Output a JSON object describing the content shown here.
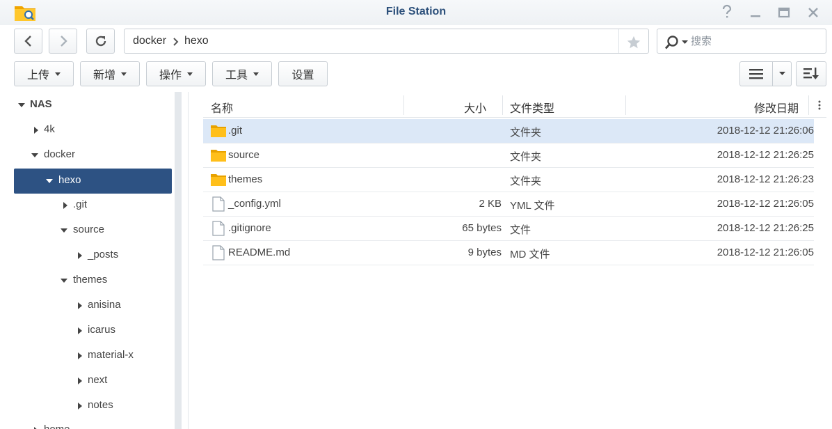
{
  "window": {
    "title": "File Station"
  },
  "nav": {
    "back": "back",
    "forward": "forward",
    "refresh": "refresh"
  },
  "path": {
    "segments": [
      "docker",
      "hexo"
    ]
  },
  "search": {
    "placeholder": "搜索"
  },
  "toolbar": {
    "upload": "上传",
    "create": "新增",
    "action": "操作",
    "tools": "工具",
    "settings": "设置"
  },
  "tree": {
    "root": "NAS",
    "items": [
      {
        "label": "4k"
      },
      {
        "label": "docker"
      },
      {
        "label": "hexo"
      },
      {
        "label": ".git"
      },
      {
        "label": "source"
      },
      {
        "label": "_posts"
      },
      {
        "label": "themes"
      },
      {
        "label": "anisina"
      },
      {
        "label": "icarus"
      },
      {
        "label": "material-x"
      },
      {
        "label": "next"
      },
      {
        "label": "notes"
      },
      {
        "label": "home"
      }
    ]
  },
  "list": {
    "columns": {
      "name": "名称",
      "size": "大小",
      "type": "文件类型",
      "modified": "修改日期"
    },
    "rows": [
      {
        "name": ".git",
        "size": "",
        "type": "文件夹",
        "modified": "2018-12-12 21:26:06",
        "kind": "folder"
      },
      {
        "name": "source",
        "size": "",
        "type": "文件夹",
        "modified": "2018-12-12 21:26:25",
        "kind": "folder"
      },
      {
        "name": "themes",
        "size": "",
        "type": "文件夹",
        "modified": "2018-12-12 21:26:23",
        "kind": "folder"
      },
      {
        "name": "_config.yml",
        "size": "2 KB",
        "type": "YML 文件",
        "modified": "2018-12-12 21:26:05",
        "kind": "file"
      },
      {
        "name": ".gitignore",
        "size": "65 bytes",
        "type": "文件",
        "modified": "2018-12-12 21:26:25",
        "kind": "file"
      },
      {
        "name": "README.md",
        "size": "9 bytes",
        "type": "MD 文件",
        "modified": "2018-12-12 21:26:05",
        "kind": "file"
      }
    ]
  },
  "colors": {
    "accent": "#2d5283",
    "selected_row": "#dce8f7",
    "folder": "#f5b400",
    "title": "#2b4f7a"
  }
}
